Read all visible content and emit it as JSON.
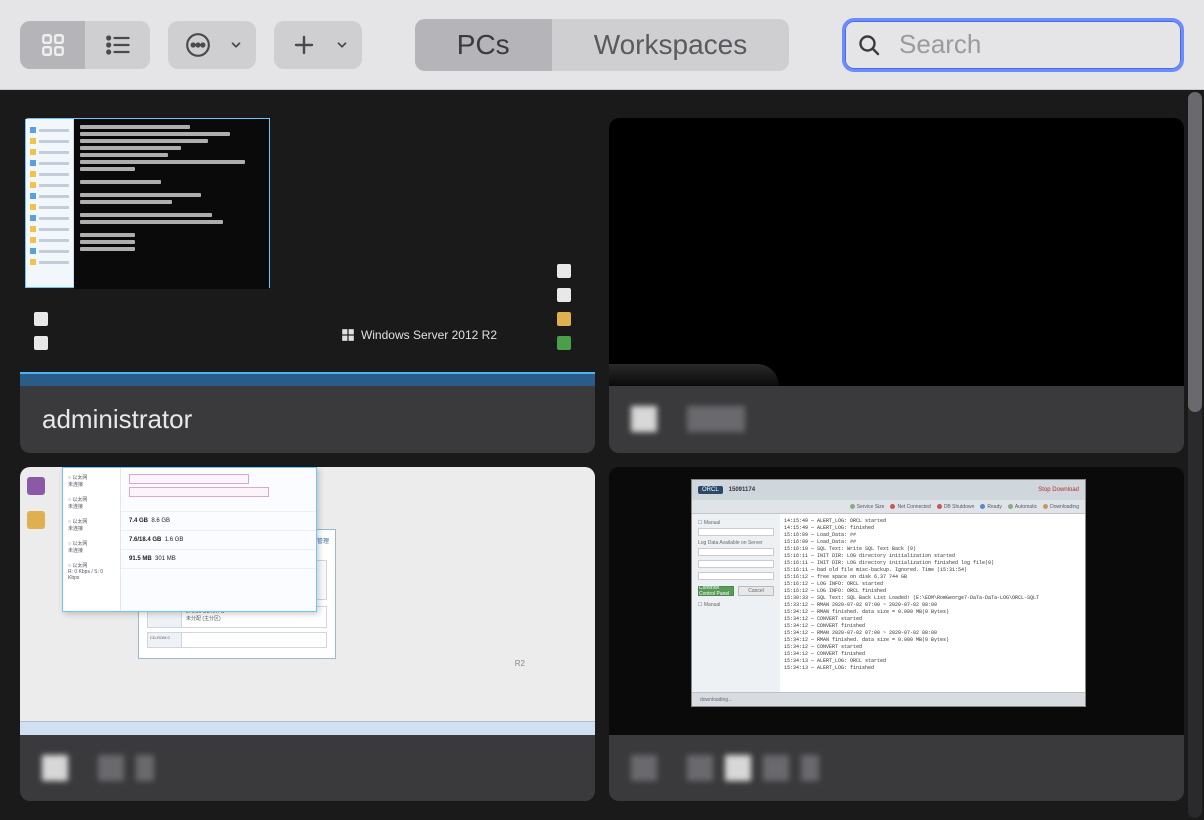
{
  "toolbar": {
    "grid_view_active": true,
    "segments": {
      "pcs": "PCs",
      "workspaces": "Workspaces"
    },
    "active_segment": "pcs"
  },
  "search": {
    "placeholder": "Search",
    "value": ""
  },
  "connections": [
    {
      "id": "pc1",
      "label": "administrator",
      "label_redacted": false,
      "thumb_brand": "Windows Server 2012 R2"
    },
    {
      "id": "pc2",
      "label": "",
      "label_redacted": true,
      "redaction_pattern": [
        "w",
        "gap",
        "d",
        "d"
      ]
    },
    {
      "id": "pc3",
      "label": "",
      "label_redacted": true,
      "redaction_pattern": [
        "w",
        "gap",
        "d",
        "s"
      ],
      "thumb_brand_suffix": "R2",
      "disk_stats": {
        "mem_used": "7.4 GB",
        "mem_total": "8.6 GB",
        "disk_used": "7.6/18.4 GB",
        "disk_free": "1.6 GB",
        "net_down": "91.5 MB",
        "net_up": "301 MB",
        "partition": "276.06 GB NTFS",
        "cdrom": "CD-ROM 0"
      }
    },
    {
      "id": "pc4",
      "label": "",
      "label_redacted": true,
      "redaction_pattern": [
        "d",
        "gap",
        "d",
        "w",
        "d",
        "d"
      ],
      "hover_actions": true,
      "console": {
        "tag": "ORCL",
        "code": "15091174",
        "stop_label": "Stop Download",
        "btn_confirm": "Common Control Panel",
        "btn_cancel": "Cancel",
        "footer": "downloading...",
        "status_chips": [
          "Service Size",
          "Net Connected",
          "DB Shutdown",
          "Ready",
          "Automatic",
          "Downloading"
        ],
        "left_labels": [
          "Manual",
          "Log Data Available on Server",
          "Manual"
        ],
        "log_lines": [
          "14:15:49 — ALERT_LOG: ORCL started",
          "14:15:49 — ALERT_LOG: finished",
          "15:16:09 — Load_Data: ##",
          "15:16:09 — Load_Data: ##",
          "15:16:10 — SQL Text: Write SQL Text Back (0)",
          "15:16:11 — INIT DIR: LOG directory initialization started",
          "15:16:11 — INIT DIR: LOG directory initialization finished log file(0)",
          "15:16:11 — bad old file misc-backup. Ignored. Time (15:31:54)",
          "15:16:12 — free space on disk  6.37 744 GB",
          "15:16:12 — LOG INFO: ORCL  started",
          "15:16:12 — LOG INFO: ORCL  finished",
          "15:30:33 — SQL Text: SQL Back List Loaded! (E:\\EDM\\RomGeorge7-DaTa-DaTa-LOG\\ORCL-SQLT",
          "15:33:12 — RMAN  2020-07-02 07:00 ~ 2020-07-02 08:00",
          "15:34:12 — RMAN  finished. data size = 0.000 MB(0 Bytes)",
          "15:34:12 — CONVERT started",
          "15:34:12 — CONVERT finished",
          "15:34:12 — RMAN  2020-07-02 07:00 ~ 2020-07-02 08:00",
          "15:34:12 — RMAN  finished. data size = 0.000 MB(0 Bytes)",
          "15:34:12 — CONVERT started",
          "15:34:12 — CONVERT finished",
          "15:34:13 — ALERT_LOG: ORCL started",
          "15:34:13 — ALERT_LOG: finished"
        ]
      }
    }
  ]
}
